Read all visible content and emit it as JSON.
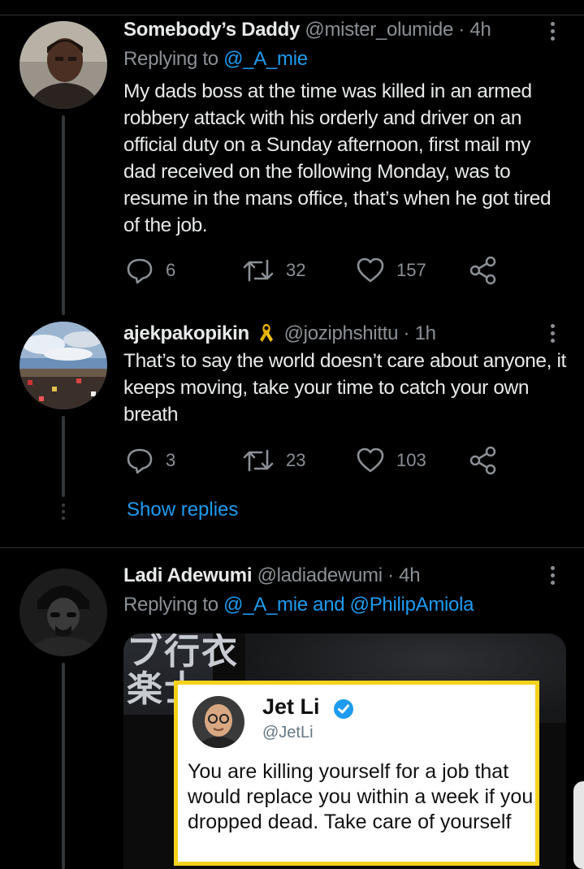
{
  "tweets": [
    {
      "name": "Somebody’s Daddy",
      "handle": "@mister_olumide",
      "time": "· 4h",
      "replying_prefix": "Replying to ",
      "replying_to": "@_A_mie",
      "text": "My dads boss at the time was killed in an armed robbery attack with his orderly and driver on an official duty on a Sunday afternoon, first mail my dad received on the following Monday, was to resume in the mans office, that’s when he got tired of the job.",
      "replies": "6",
      "retweets": "32",
      "likes": "157"
    },
    {
      "name": "ajekpakopikin",
      "badge": "ribbon-icon",
      "handle": "@joziphshittu",
      "time": "· 1h",
      "text": "That’s to say the world doesn’t care about anyone, it keeps moving, take your time to catch your own breath",
      "replies": "3",
      "retweets": "23",
      "likes": "103"
    },
    {
      "name": "Ladi Adewumi",
      "handle": "@ladiadewumi",
      "time": "· 4h",
      "replying_prefix": "Replying to ",
      "replying_to": "@_A_mie and @PhilipAmiola"
    }
  ],
  "show_replies": "Show replies",
  "media": {
    "background_chars": "ブ行衣\n楽士",
    "card_name": "Jet Li",
    "card_handle": "@JetLi",
    "card_text": "You are killing yourself for a job that would replace you within a week if you dropped dead. Take care of yourself"
  },
  "colors": {
    "background": "#000000",
    "link": "#1d9bf0",
    "secondary_text": "#8b9096",
    "card_border": "#f5d21b"
  },
  "icons": [
    "reply-icon",
    "retweet-icon",
    "like-icon",
    "share-icon",
    "more-vertical-icon",
    "verified-badge-icon",
    "ribbon-icon"
  ]
}
